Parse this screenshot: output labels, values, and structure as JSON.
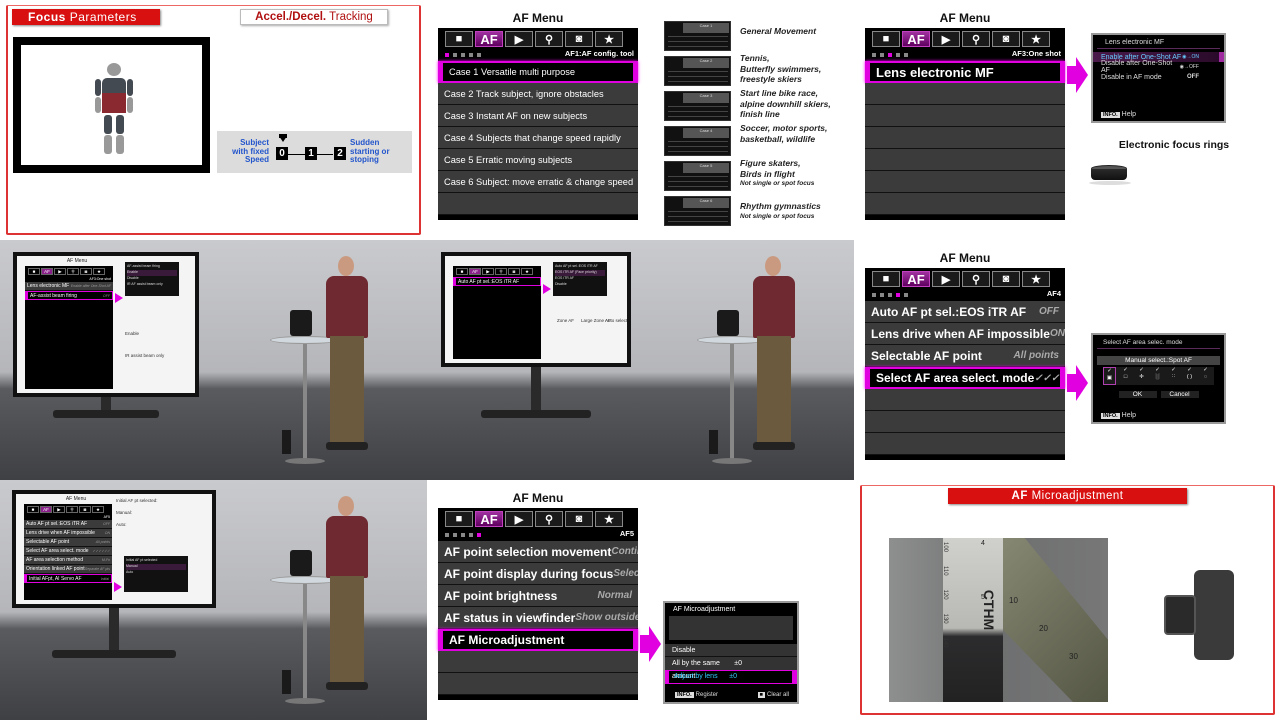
{
  "colors": {
    "accent": "#e000e0",
    "slide_red": "#dd1111",
    "blue_text": "#2255cc"
  },
  "tab_icons": [
    "camera-icon",
    "af-tab",
    "playback-icon",
    "wrench-icon",
    "custom-camera-icon",
    "star-icon"
  ],
  "tab_glyphs": [
    "■",
    "AF",
    "▶",
    "⚲",
    "◙",
    "★"
  ],
  "focus_slide": {
    "title_bold": "Focus",
    "title_rest": "Parameters",
    "subtitle_bold": "Accel./Decel.",
    "subtitle_rest": "Tracking",
    "left_label": [
      "Subject",
      "with fixed",
      "Speed"
    ],
    "scale": [
      "0",
      "1",
      "2"
    ],
    "right_label": [
      "Sudden",
      "starting or",
      "stoping"
    ]
  },
  "menus": {
    "af1": {
      "title": "AF Menu",
      "page": "AF1:AF config. tool",
      "active_dot": 0,
      "selected": 0,
      "rows": [
        {
          "label": "Case 1 Versatile multi purpose",
          "value": ""
        },
        {
          "label": "Case 2 Track subject, ignore obstacles",
          "value": ""
        },
        {
          "label": "Case 3 Instant AF on new subjects",
          "value": ""
        },
        {
          "label": "Case 4 Subjects that change speed rapidly",
          "value": ""
        },
        {
          "label": "Case 5 Erratic moving subjects",
          "value": ""
        },
        {
          "label": "Case 6 Subject: move erratic & change speed",
          "value": ""
        },
        {
          "label": "",
          "value": ""
        }
      ]
    },
    "af3": {
      "title": "AF Menu",
      "page": "AF3:One shot",
      "active_dot": 2,
      "selected": 0,
      "rows": [
        {
          "label": "Lens electronic MF",
          "value": ""
        },
        {
          "label": "",
          "value": ""
        },
        {
          "label": "",
          "value": ""
        },
        {
          "label": "",
          "value": ""
        },
        {
          "label": "",
          "value": ""
        },
        {
          "label": "",
          "value": ""
        },
        {
          "label": "",
          "value": ""
        }
      ]
    },
    "af4": {
      "title": "AF Menu",
      "page": "AF4",
      "active_dot": 3,
      "selected": 3,
      "rows": [
        {
          "label": "Auto AF pt sel.:EOS iTR AF",
          "value": "OFF"
        },
        {
          "label": "Lens drive when AF impossible",
          "value": "ON"
        },
        {
          "label": "Selectable AF point",
          "value": "All points"
        },
        {
          "label": "Select AF area select. mode",
          "value": "✓✓✓✓✓✓✓"
        },
        {
          "label": "",
          "value": ""
        },
        {
          "label": "",
          "value": ""
        },
        {
          "label": "",
          "value": ""
        }
      ]
    },
    "af5": {
      "title": "AF Menu",
      "page": "AF5",
      "active_dot": 4,
      "selected": 4,
      "rows": [
        {
          "label": "AF point selection movement",
          "value": "Continuous"
        },
        {
          "label": "AF point display during focus",
          "value": "Selected AF points"
        },
        {
          "label": "AF point brightness",
          "value": "Normal"
        },
        {
          "label": "AF status in viewfinder",
          "value": "Show outside view"
        },
        {
          "label": "AF Microadjustment",
          "value": ""
        },
        {
          "label": "",
          "value": ""
        },
        {
          "label": "",
          "value": ""
        }
      ]
    }
  },
  "cases": [
    {
      "thumb": "Case 1",
      "lines": [
        "General Movement"
      ],
      "note": ""
    },
    {
      "thumb": "Case 2",
      "lines": [
        "Tennis,",
        "Butterfly swimmers,",
        "freestyle skiers"
      ],
      "note": ""
    },
    {
      "thumb": "Case 3",
      "lines": [
        "Start line bike race,",
        "alpine downhill skiers,",
        "finish line"
      ],
      "note": ""
    },
    {
      "thumb": "Case 4",
      "lines": [
        "Soccer, motor sports,",
        "basketball, wildlife"
      ],
      "note": ""
    },
    {
      "thumb": "Case 5",
      "lines": [
        "Figure skaters,",
        "Birds in flight"
      ],
      "note": "Not single or spot focus"
    },
    {
      "thumb": "Case 6",
      "lines": [
        "Rhythm gymnastics"
      ],
      "note": "Not single or spot focus"
    }
  ],
  "lens_mf_popup": {
    "title": "Lens electronic MF",
    "options": [
      {
        "label": "Enable after One-Shot AF",
        "value": "◉→ON"
      },
      {
        "label": "Disable after One-Shot AF",
        "value": "◉→OFF"
      },
      {
        "label": "Disable in AF mode",
        "value": "OFF"
      }
    ],
    "selected": 0,
    "info": "INFO.",
    "help": "Help"
  },
  "focus_rings_label": "Electronic focus rings",
  "area_popup": {
    "title": "Select AF area selec. mode",
    "current": "Manual select.:Spot AF",
    "modes": [
      "▣",
      "□",
      "✛",
      "░",
      "∷",
      "( )",
      "◌"
    ],
    "check": "✓",
    "ok": "OK",
    "cancel": "Cancel",
    "info": "INFO.",
    "help": "Help"
  },
  "micro_popup": {
    "title": "AF Microadjustment",
    "options": [
      {
        "label": "Disable",
        "value": ""
      },
      {
        "label": "All by the same amount",
        "value": "±0"
      },
      {
        "label": "Adjust by lens",
        "value": "±0"
      }
    ],
    "selected": 2,
    "info": "INFO.",
    "register": "Register",
    "trash": "■",
    "clear": "Clear all"
  },
  "micro_slide": {
    "title_bold": "AF",
    "title_rest": "Microadjustment",
    "ruler_numbers": [
      "100",
      "110",
      "120",
      "130",
      "140",
      "4",
      "5",
      "10",
      "20",
      "30"
    ],
    "ruler_brand": "CTHM"
  },
  "videos": [
    {
      "title": "AF Menu",
      "page": "AF3:One shot",
      "rows": [
        {
          "label": "Lens electronic MF",
          "value": "Enable after One-Shot AF"
        },
        {
          "label": "AF-assist beam firing",
          "value": "OFF"
        }
      ],
      "selected": 1,
      "popup": [
        "AF-assist beam firing",
        "Enable",
        "Disable",
        "IR AF assist beam only"
      ],
      "labels": [
        "Enable",
        "IR assist beam only"
      ]
    },
    {
      "title": "",
      "page": "",
      "rows": [
        {
          "label": "Auto AF pt sel.:EOS iTR AF",
          "value": ""
        }
      ],
      "selected": 0,
      "popup": [
        "Auto AF pt sel.:EOS iTR AF",
        "EOS iTR AF (Face priority)",
        "EOS iTR AF",
        "Disable"
      ],
      "labels": [
        "Zone AF",
        "Large Zone AF",
        "Auto selection AF"
      ]
    },
    {
      "title": "AF Menu",
      "page": "AF5",
      "rows": [
        {
          "label": "Auto AF pt sel.:EOS iTR AF",
          "value": "OFF"
        },
        {
          "label": "Lens drive when AF impossible",
          "value": "ON"
        },
        {
          "label": "Selectable AF point",
          "value": "All points"
        },
        {
          "label": "Select AF area select. mode",
          "value": "✓✓✓✓✓✓"
        },
        {
          "label": "AF area selection method",
          "value": "M-Fn"
        },
        {
          "label": "Orientation linked AF point",
          "value": "Separate AF pts"
        },
        {
          "label": "Initial AFpt, AI Servo AF",
          "value": "Initial"
        }
      ],
      "selected": 6,
      "popup": [
        "Initial AF pt selected",
        "Manual",
        "Auto"
      ],
      "labels": [
        "Initial AF pt selected:",
        "Manual:",
        "Auto:"
      ]
    }
  ]
}
